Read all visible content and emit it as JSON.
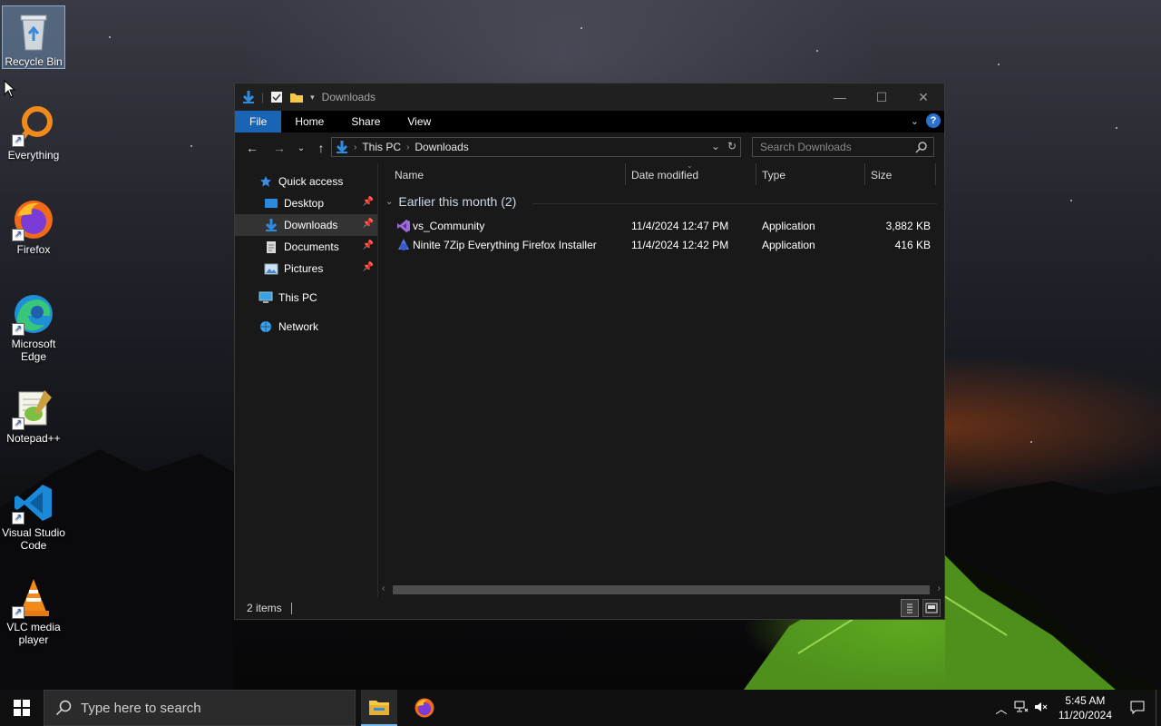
{
  "desktop": {
    "icons": [
      {
        "label": "Recycle Bin"
      },
      {
        "label": "Everything"
      },
      {
        "label": "Firefox"
      },
      {
        "label": "Microsoft Edge"
      },
      {
        "label": "Notepad++"
      },
      {
        "label": "Visual Studio Code"
      },
      {
        "label": "VLC media player"
      }
    ]
  },
  "window": {
    "title": "Downloads",
    "ribbon": {
      "file": "File",
      "home": "Home",
      "share": "Share",
      "view": "View",
      "help": "?"
    },
    "address": {
      "crumbs": [
        "This PC",
        "Downloads"
      ]
    },
    "search": {
      "placeholder": "Search Downloads"
    },
    "navpane": {
      "quick_access": "Quick access",
      "items": [
        "Desktop",
        "Downloads",
        "Documents",
        "Pictures"
      ],
      "this_pc": "This PC",
      "network": "Network"
    },
    "columns": {
      "name": "Name",
      "date": "Date modified",
      "type": "Type",
      "size": "Size"
    },
    "group": {
      "label": "Earlier this month (2)"
    },
    "files": [
      {
        "name": "vs_Community",
        "date": "11/4/2024 12:47 PM",
        "type": "Application",
        "size": "3,882 KB"
      },
      {
        "name": "Ninite 7Zip Everything Firefox Installer",
        "date": "11/4/2024 12:42 PM",
        "type": "Application",
        "size": "416 KB"
      }
    ],
    "status": {
      "count": "2 items"
    }
  },
  "taskbar": {
    "search_placeholder": "Type here to search",
    "time": "5:45 AM",
    "date": "11/20/2024"
  },
  "colors": {
    "accent": "#1a64b5",
    "window_bg": "#191919",
    "taskbar": "#101010"
  }
}
